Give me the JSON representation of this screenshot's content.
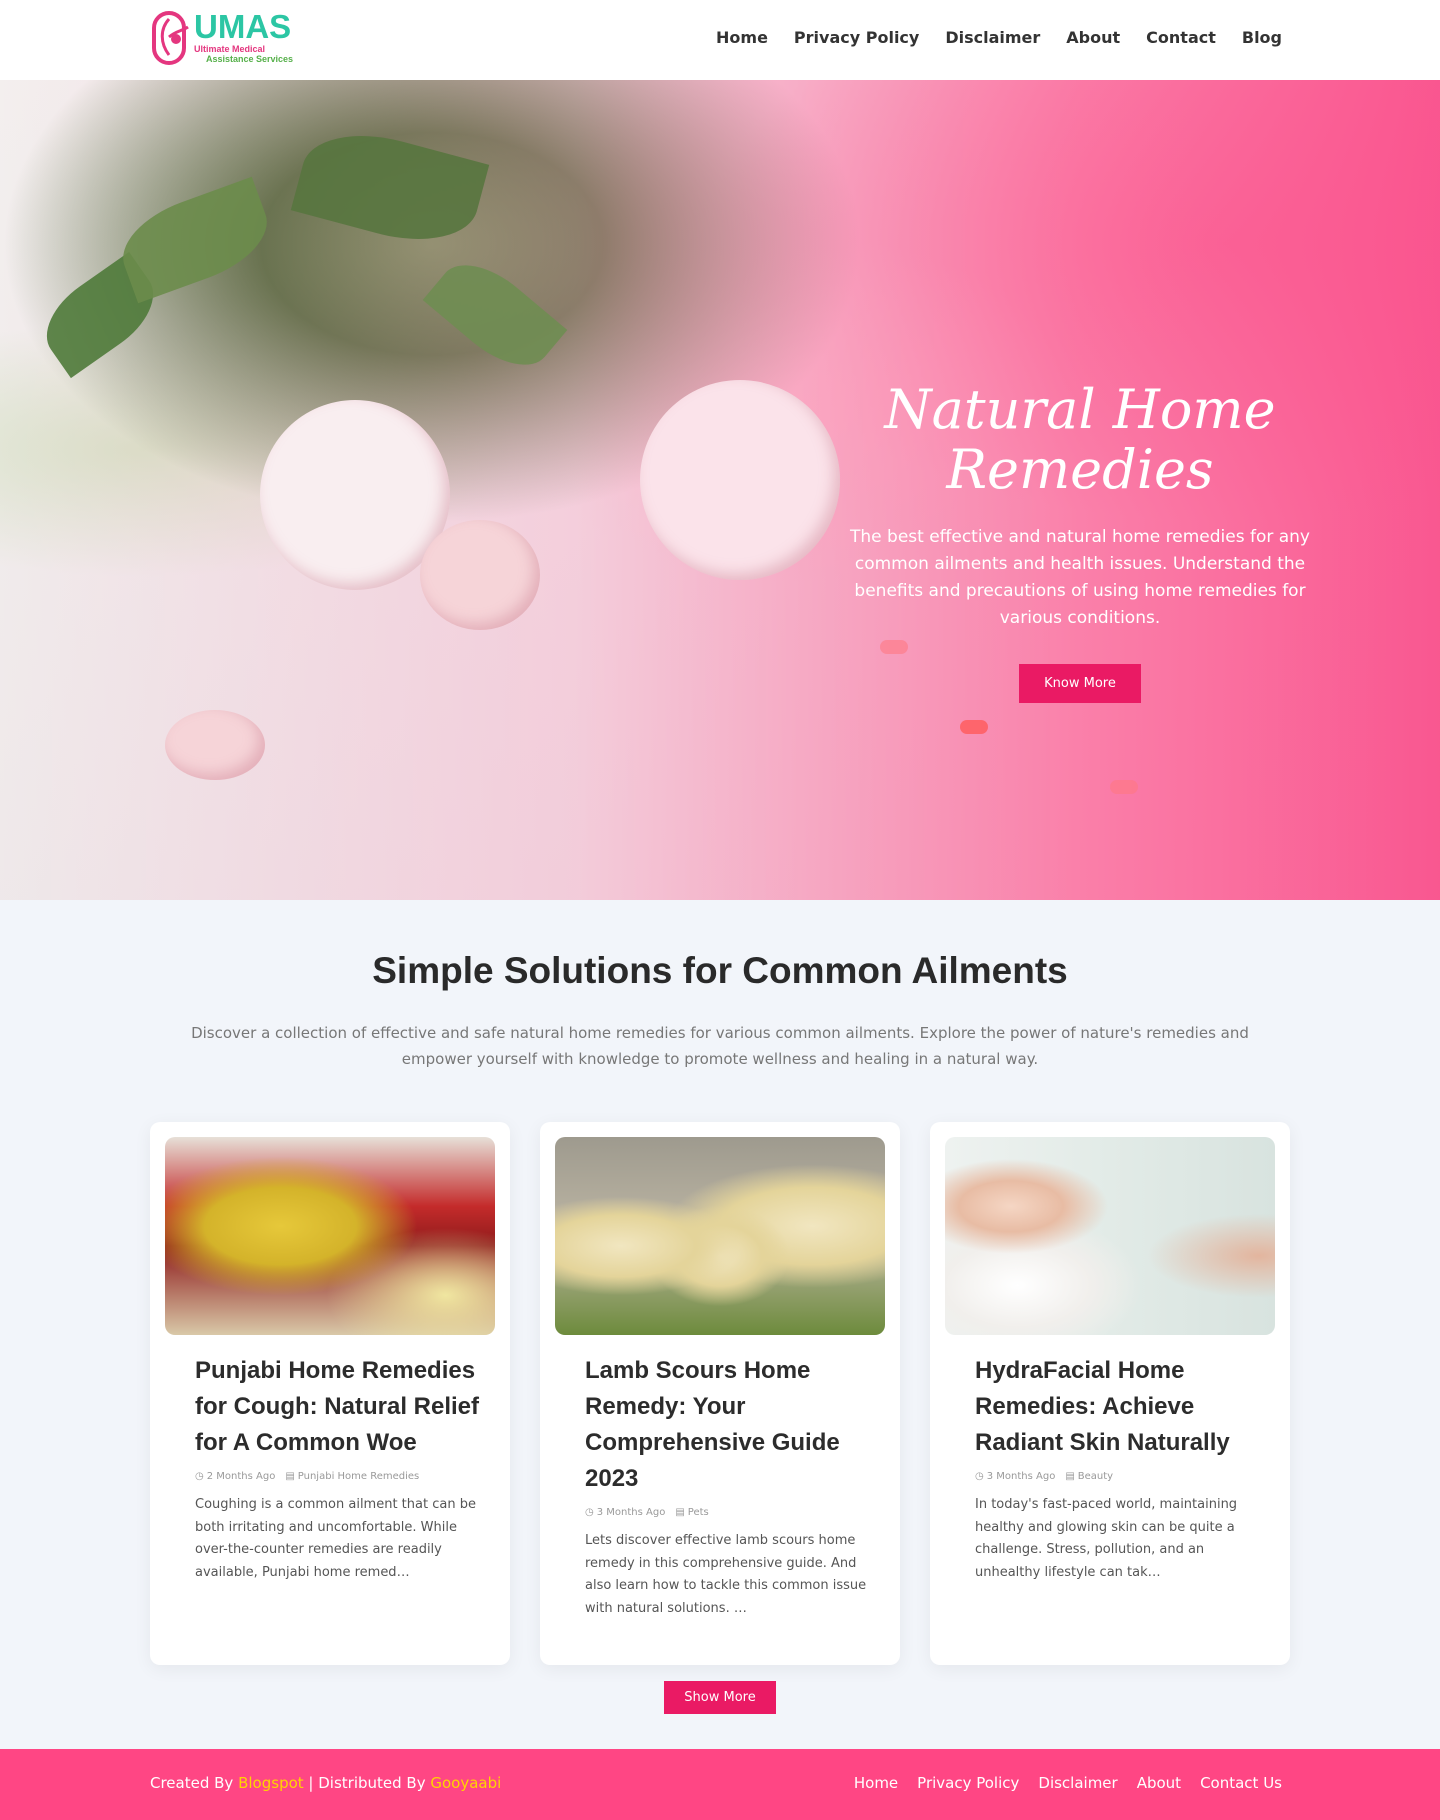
{
  "header": {
    "logo": {
      "abbr": "UMAS",
      "line1": "Ultimate Medical",
      "line2": "Assistance Services"
    },
    "nav": [
      "Home",
      "Privacy Policy",
      "Disclaimer",
      "About",
      "Contact",
      "Blog"
    ]
  },
  "hero": {
    "title_line1": "Natural Home",
    "title_line2": "Remedies",
    "description": "The best effective and natural home remedies for any common ailments and health issues. Understand the benefits and precautions of using home remedies for various conditions.",
    "button": "Know More"
  },
  "section": {
    "title": "Simple Solutions for Common Ailments",
    "description": "Discover a collection of effective and safe natural home remedies for various common ailments. Explore the power of nature's remedies and empower yourself with knowledge to promote wellness and healing in a natural way."
  },
  "cards": [
    {
      "title": "Punjabi Home Remedies for Cough: Natural Relief for A Common Woe",
      "time": "2 Months Ago",
      "category": "Punjabi Home Remedies",
      "excerpt": "Coughing is a common ailment that can be both irritating and uncomfortable. While over-the-counter remedies are readily available, Punjabi home remed…"
    },
    {
      "title": "Lamb Scours Home Remedy: Your Comprehensive Guide 2023",
      "time": "3 Months Ago",
      "category": "Pets",
      "excerpt": "Lets discover effective lamb scours home remedy in this comprehensive guide. And also learn how to tackle this common issue with natural solutions. …"
    },
    {
      "title": "HydraFacial Home Remedies: Achieve Radiant Skin Naturally",
      "time": "3 Months Ago",
      "category": "Beauty",
      "excerpt": "In today's fast-paced world, maintaining healthy and glowing skin can be quite a challenge. Stress, pollution, and an unhealthy lifestyle can tak…"
    }
  ],
  "show_more": "Show More",
  "footer": {
    "created_by": "Created By",
    "blogspot": "Blogspot",
    "separator": " | Distributed By ",
    "gooyaabi": "Gooyaabi",
    "links": [
      "Home",
      "Privacy Policy",
      "Disclaimer",
      "About",
      "Contact Us"
    ]
  },
  "colors": {
    "accent": "#ea1a64",
    "footer_bg": "#ff4684",
    "logo_green": "#2cc6a4",
    "footer_highlight": "#ffd400"
  }
}
